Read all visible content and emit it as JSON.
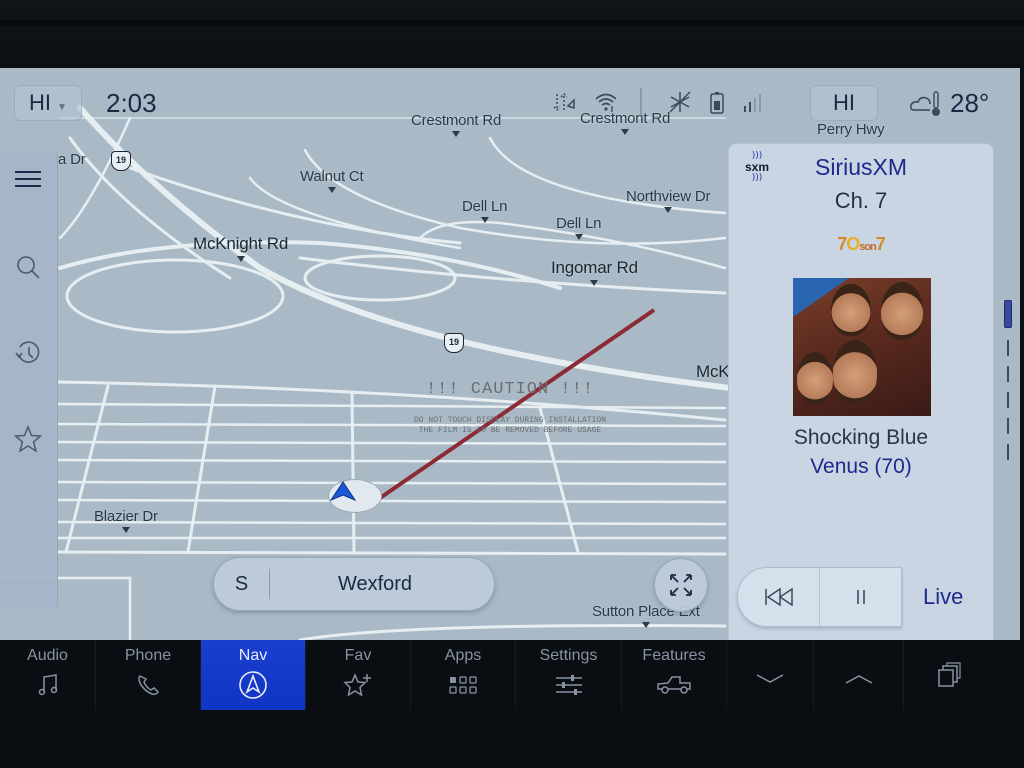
{
  "status_bar": {
    "climate_left": "HI",
    "climate_right": "HI",
    "clock": "2:03",
    "temperature": "28°",
    "icons": [
      "traffic-arrows-icon",
      "wifi-icon",
      "mute-icon",
      "defrost-off-icon",
      "battery-icon",
      "signal-strength-icon",
      "weather-cloud-thermometer-icon"
    ]
  },
  "map": {
    "road_labels": [
      {
        "id": "crestmont-1",
        "text": "Crestmont Rd"
      },
      {
        "id": "crestmont-2",
        "text": "Crestmont Rd"
      },
      {
        "id": "perry-hwy",
        "text": "Perry Hwy"
      },
      {
        "id": "walnut-ct",
        "text": "Walnut Ct"
      },
      {
        "id": "dell-ln-1",
        "text": "Dell Ln"
      },
      {
        "id": "dell-ln-2",
        "text": "Dell Ln"
      },
      {
        "id": "northview-dr",
        "text": "Northview Dr"
      },
      {
        "id": "mcknight-rd",
        "text": "McKnight Rd"
      },
      {
        "id": "ingomar-rd",
        "text": "Ingomar Rd"
      },
      {
        "id": "blazier-dr",
        "text": "Blazier Dr"
      },
      {
        "id": "sutton-place-ext",
        "text": "Sutton Place Ext"
      },
      {
        "id": "a-dr",
        "text": "a Dr"
      },
      {
        "id": "mck-partial",
        "text": "McK"
      }
    ],
    "route_shields": [
      "19",
      "19"
    ],
    "heading": "S",
    "destination": "Wexford",
    "caution_film": {
      "title": "!!! CAUTION !!!",
      "line1": "DO NOT TOUCH DISPLAY DURING INSTALLATION",
      "line2": "THE FILM IS TO BE REMOVED BEFORE USAGE"
    }
  },
  "side_panel": {
    "items": [
      {
        "name": "menu",
        "icon": "hamburger-menu-icon"
      },
      {
        "name": "search",
        "icon": "search-icon"
      },
      {
        "name": "recent",
        "icon": "history-icon"
      },
      {
        "name": "favorites",
        "icon": "star-icon"
      }
    ]
  },
  "audio": {
    "logo": "sxm",
    "provider": "SiriusXM",
    "channel": "Ch. 7",
    "station_logo": {
      "part1": "7",
      "part2": "O",
      "part3": "son",
      "part4": "7"
    },
    "artist": "Shocking Blue",
    "song": "Venus (70)",
    "controls": {
      "rewind": "rewind-icon",
      "pause": "pause-icon"
    },
    "live_label": "Live"
  },
  "bottom_nav": {
    "items": [
      {
        "label": "Audio",
        "icon": "music-note-icon",
        "active": false
      },
      {
        "label": "Phone",
        "icon": "phone-icon",
        "active": false
      },
      {
        "label": "Nav",
        "icon": "navigation-icon",
        "active": true
      },
      {
        "label": "Fav",
        "icon": "star-plus-icon",
        "active": false
      },
      {
        "label": "Apps",
        "icon": "apps-grid-icon",
        "active": false
      },
      {
        "label": "Settings",
        "icon": "sliders-icon",
        "active": false
      },
      {
        "label": "Features",
        "icon": "truck-icon",
        "active": false
      }
    ],
    "controls": [
      "chevron-down-icon",
      "chevron-up-icon",
      "recent-apps-icon"
    ]
  },
  "colors": {
    "accent_blue": "#1a3fd0",
    "text_blue": "#1e2a8c",
    "route_line": "#8c2a36"
  }
}
